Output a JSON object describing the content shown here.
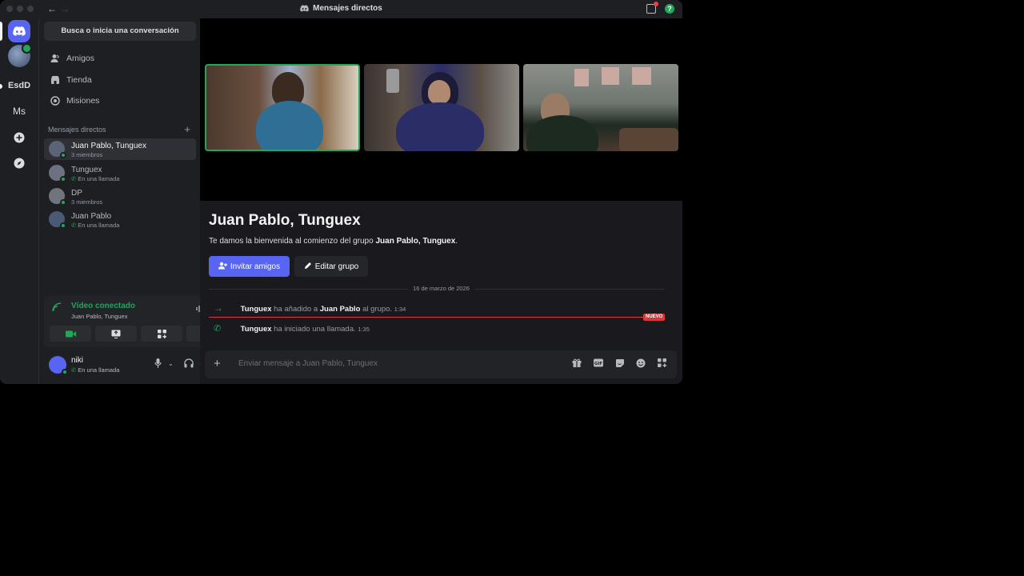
{
  "window": {
    "title": "Mensajes directos",
    "back": "←",
    "forward": "→",
    "help": "?"
  },
  "rail": {
    "items": [
      {
        "label": "EsdD"
      },
      {
        "label": "Ms"
      }
    ],
    "add": "+",
    "discover": "⊘"
  },
  "sidebar": {
    "search_label": "Busca o inicia una conversación",
    "nav": [
      {
        "label": "Amigos",
        "icon": "friends-icon"
      },
      {
        "label": "Tienda",
        "icon": "store-icon"
      },
      {
        "label": "Misiones",
        "icon": "quests-icon"
      }
    ],
    "dm_header": "Mensajes directos",
    "dm_add": "+",
    "dms": [
      {
        "name": "Juan Pablo, Tunguex",
        "sub": "3 miembros",
        "in_call": false,
        "active": true,
        "avatar_color": "#5b6477"
      },
      {
        "name": "Tunguex",
        "sub": "En una llamada",
        "in_call": true,
        "active": false,
        "avatar_color": "#6c7280"
      },
      {
        "name": "DP",
        "sub": "3 miembros",
        "in_call": false,
        "active": false,
        "avatar_color": "#70757d"
      },
      {
        "name": "Juan Pablo",
        "sub": "En una llamada",
        "in_call": true,
        "active": false,
        "avatar_color": "#4a5a75"
      }
    ]
  },
  "voice": {
    "status": "Vídeo conectado",
    "channel": "Juan Pablo, Tunguex",
    "buttons": [
      "camera-icon",
      "screen-share-icon",
      "activities-icon",
      "soundboard-icon"
    ]
  },
  "user": {
    "name": "niki",
    "status": "En una llamada"
  },
  "chat": {
    "title": "Juan Pablo, Tunguex",
    "welcome_prefix": "Te damos la bienvenida al comienzo del grupo ",
    "welcome_group": "Juan Pablo, Tunguex",
    "welcome_suffix": ".",
    "invite_label": "Invitar amigos",
    "edit_label": "Editar grupo",
    "date": "16 de marzo de 2026",
    "messages": [
      {
        "actor": "Tunguex",
        "text1": " ha añadido a ",
        "target": "Juan Pablo",
        "text2": " al grupo. ",
        "time": "1:34"
      },
      {
        "actor": "Tunguex",
        "text1": " ha iniciado una llamada. ",
        "time": "1:35"
      }
    ],
    "new_badge": "NUEVO",
    "composer_placeholder": "Enviar mensaje a Juan Pablo, Tunguex"
  },
  "colors": {
    "accent": "#5865f2",
    "online": "#23a55a",
    "danger": "#da373c"
  }
}
